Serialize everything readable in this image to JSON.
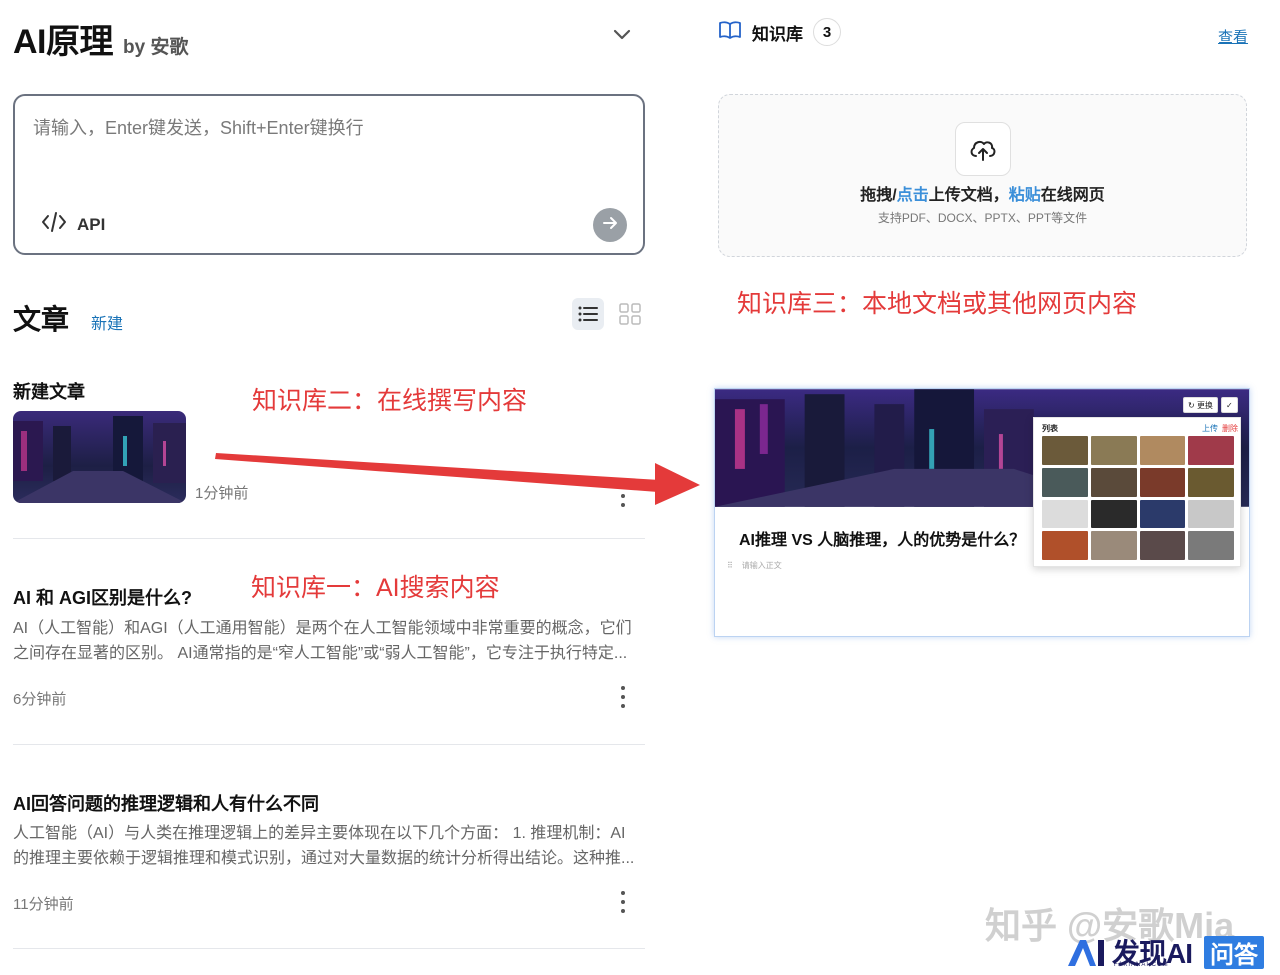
{
  "header": {
    "title": "AI原理",
    "byline": "by 安歌"
  },
  "composer": {
    "placeholder": "请输入，Enter键发送，Shift+Enter键换行",
    "api_label": "API"
  },
  "articles": {
    "title": "文章",
    "new_label": "新建",
    "items": [
      {
        "title": "新建文章",
        "time": "1分钟前"
      },
      {
        "title": "AI 和 AGI区别是什么?",
        "excerpt": "AI（人工智能）和AGI（人工通用智能）是两个在人工智能领域中非常重要的概念，它们之间存在显著的区别。 AI通常指的是“窄人工智能”或“弱人工智能”，它专注于执行特定...",
        "time": "6分钟前"
      },
      {
        "title": "AI回答问题的推理逻辑和人有什么不同",
        "excerpt": "人工智能（AI）与人类在推理逻辑上的差异主要体现在以下几个方面： 1. 推理机制：AI的推理主要依赖于逻辑推理和模式识别，通过对大量数据的统计分析得出结论。这种推...",
        "time": "11分钟前"
      }
    ]
  },
  "annotations": {
    "kb3": "知识库三：本地文档或其他网页内容",
    "kb2": "知识库二：在线撰写内容",
    "kb1": "知识库一：AI搜索内容"
  },
  "knowledge_base": {
    "label": "知识库",
    "count": "3",
    "view_label": "查看",
    "upload": {
      "part1": "拖拽/",
      "part2": "点击",
      "part3": "上传文档，",
      "part4": "粘贴",
      "part5": "在线网页",
      "sub": "支持PDF、DOCX、PPTX、PPT等文件"
    }
  },
  "preview_card": {
    "title": "AI推理 VS 人脑推理，人的优势是什么？",
    "hint": "请输入正文",
    "popup_title": "列表",
    "popup_upload": "上传",
    "popup_remove": "删除",
    "btn_replace": "更换"
  },
  "watermark": "知乎 @安歌Mia",
  "brand": {
    "name": "发现AI",
    "sub": "FAXIANAI.COM",
    "qa": "问答"
  },
  "colors": {
    "accent": "#1a73b7",
    "annotation": "#e43a3a",
    "upload_highlight": "#3b8fd9"
  },
  "icons": [
    "chevron-down-icon",
    "code-icon",
    "arrow-right-icon",
    "list-view-icon",
    "grid-view-icon",
    "more-vertical-icon",
    "book-icon",
    "cloud-upload-icon"
  ]
}
